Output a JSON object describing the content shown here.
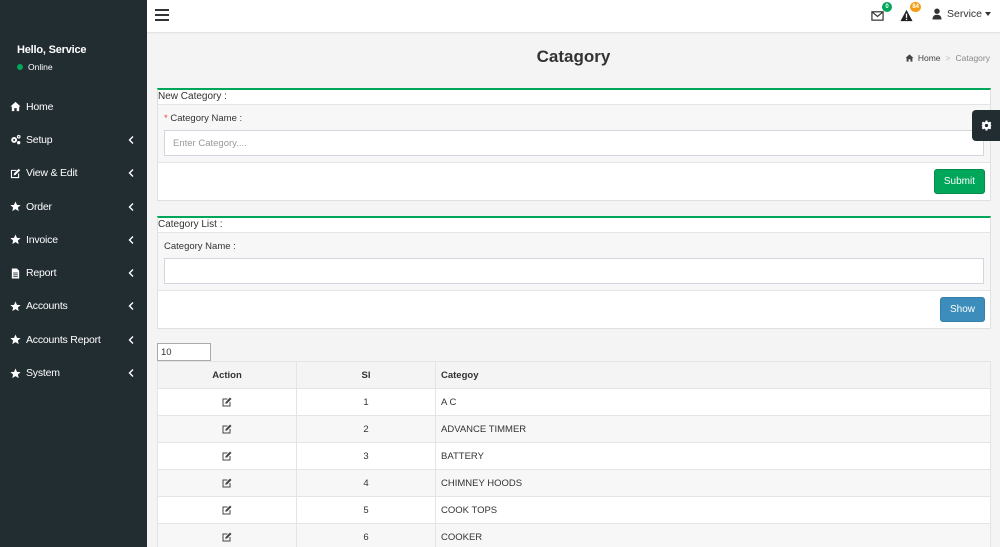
{
  "sidebar": {
    "user": {
      "greeting": "Hello, Service",
      "status": "Online"
    },
    "items": [
      {
        "label": "Home",
        "icon": "home-icon",
        "has_children": false
      },
      {
        "label": "Setup",
        "icon": "gears-icon",
        "has_children": true
      },
      {
        "label": "View & Edit",
        "icon": "edit-icon",
        "has_children": true
      },
      {
        "label": "Order",
        "icon": "star-icon",
        "has_children": true
      },
      {
        "label": "Invoice",
        "icon": "star-icon",
        "has_children": true
      },
      {
        "label": "Report",
        "icon": "file-icon",
        "has_children": true
      },
      {
        "label": "Accounts",
        "icon": "star-icon",
        "has_children": true
      },
      {
        "label": "Accounts Report",
        "icon": "star-icon",
        "has_children": true
      },
      {
        "label": "System",
        "icon": "star-icon",
        "has_children": true
      }
    ]
  },
  "header": {
    "messages_count": "0",
    "alerts_count": "84",
    "user_label": "Service"
  },
  "page": {
    "title": "Catagory",
    "breadcrumb": {
      "home": "Home",
      "current": "Catagory"
    }
  },
  "new_category": {
    "title": "New Category :",
    "required_mark": "*",
    "field_label": "Category Name :",
    "placeholder": "Enter Category....",
    "value": "",
    "submit_label": "Submit"
  },
  "category_list": {
    "title": "Category List :",
    "field_label": "Category Name :",
    "value": "",
    "show_label": "Show"
  },
  "table": {
    "page_size": "10",
    "headers": {
      "action": "Action",
      "sl": "Sl",
      "category": "Categoy"
    },
    "rows": [
      {
        "sl": "1",
        "category": "A C"
      },
      {
        "sl": "2",
        "category": "ADVANCE TIMMER"
      },
      {
        "sl": "3",
        "category": "BATTERY"
      },
      {
        "sl": "4",
        "category": "CHIMNEY HOODS"
      },
      {
        "sl": "5",
        "category": "COOK TOPS"
      },
      {
        "sl": "6",
        "category": "COOKER"
      }
    ]
  },
  "colors": {
    "sidebar_bg": "#222d32",
    "success": "#00a65a",
    "primary": "#3c8dbc",
    "warning": "#f39c12"
  }
}
